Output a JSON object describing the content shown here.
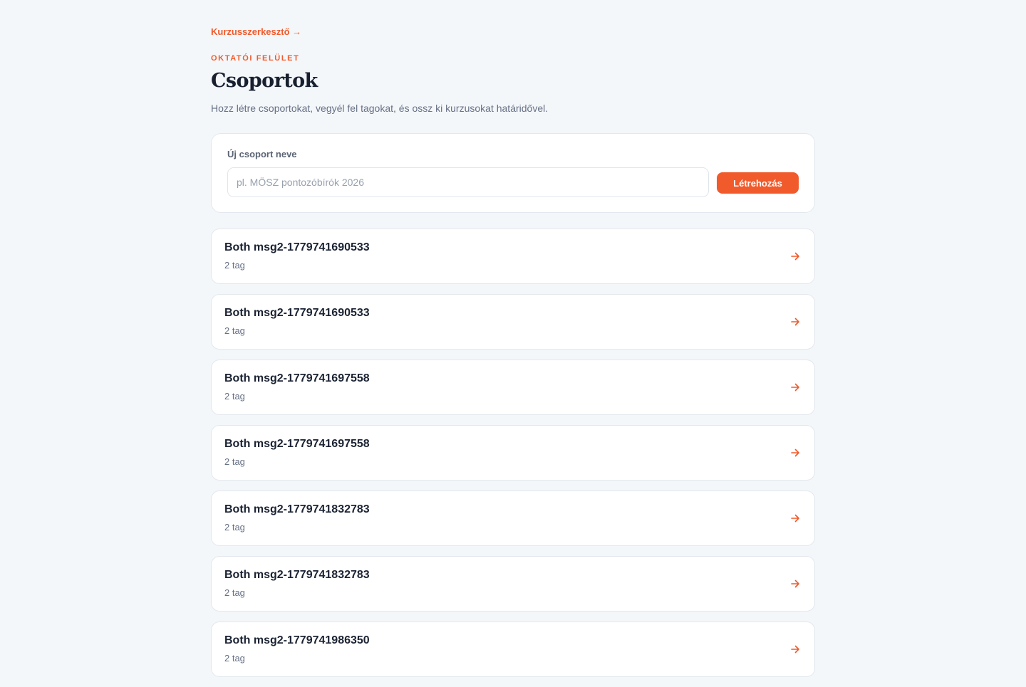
{
  "header": {
    "back_link": "Kurzusszerkesztő →",
    "eyebrow": "OKTATÓI FELÜLET",
    "title": "Csoportok",
    "subtitle": "Hozz létre csoportokat, vegyél fel tagokat, és ossz ki kurzusokat határidővel."
  },
  "create_form": {
    "label": "Új csoport neve",
    "value": "",
    "placeholder": "pl. MÖSZ pontozóbírók 2026",
    "button_label": "Létrehozás"
  },
  "groups": [
    {
      "name": "Both msg2-1779741690533",
      "members": "2 tag"
    },
    {
      "name": "Both msg2-1779741690533",
      "members": "2 tag"
    },
    {
      "name": "Both msg2-1779741697558",
      "members": "2 tag"
    },
    {
      "name": "Both msg2-1779741697558",
      "members": "2 tag"
    },
    {
      "name": "Both msg2-1779741832783",
      "members": "2 tag"
    },
    {
      "name": "Both msg2-1779741832783",
      "members": "2 tag"
    },
    {
      "name": "Both msg2-1779741986350",
      "members": "2 tag"
    }
  ],
  "icons": {
    "row_arrow": "arrow-right-icon"
  },
  "colors": {
    "accent": "#f15a2b",
    "background": "#f4f7fa",
    "card": "#ffffff",
    "text": "#1b2333",
    "muted": "#667085"
  }
}
